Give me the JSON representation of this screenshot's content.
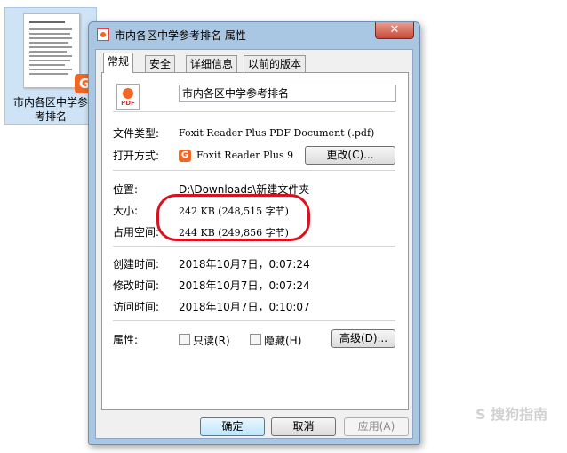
{
  "desktop": {
    "file_name": "市内各区中学参考排名",
    "file_name_line1": "市内各区中学参",
    "file_name_line2": "考排名",
    "badge_icon": "foxit-icon"
  },
  "dialog": {
    "title": "市内各区中学参考排名 属性",
    "close_label": "✕",
    "tabs": [
      {
        "label": "常规",
        "active": true
      },
      {
        "label": "安全",
        "active": false
      },
      {
        "label": "详细信息",
        "active": false
      },
      {
        "label": "以前的版本",
        "active": false
      }
    ],
    "general": {
      "file_name": "市内各区中学参考排名",
      "file_type_label": "文件类型:",
      "file_type_value": "Foxit Reader Plus PDF Document (.pdf)",
      "open_with_label": "打开方式:",
      "open_with_value": "Foxit Reader Plus 9",
      "change_button": "更改(C)...",
      "location_label": "位置:",
      "location_value": "D:\\Downloads\\新建文件夹",
      "size_label": "大小:",
      "size_value": "242 KB (248,515 字节)",
      "size_on_disk_label": "占用空间:",
      "size_on_disk_value": "244 KB (249,856 字节)",
      "created_label": "创建时间:",
      "created_value": "2018年10月7日，0:07:24",
      "modified_label": "修改时间:",
      "modified_value": "2018年10月7日，0:07:24",
      "accessed_label": "访问时间:",
      "accessed_value": "2018年10月7日，0:10:07",
      "attributes_label": "属性:",
      "readonly_label": "只读(R)",
      "readonly_checked": false,
      "hidden_label": "隐藏(H)",
      "hidden_checked": false,
      "advanced_button": "高级(D)..."
    },
    "buttons": {
      "ok": "确定",
      "cancel": "取消",
      "apply": "应用(A)"
    }
  },
  "watermark": "S 搜狗指南",
  "colors": {
    "highlight_ring": "#d9121f",
    "foxit_orange": "#f26522",
    "window_frame": "#a9c6e3"
  }
}
